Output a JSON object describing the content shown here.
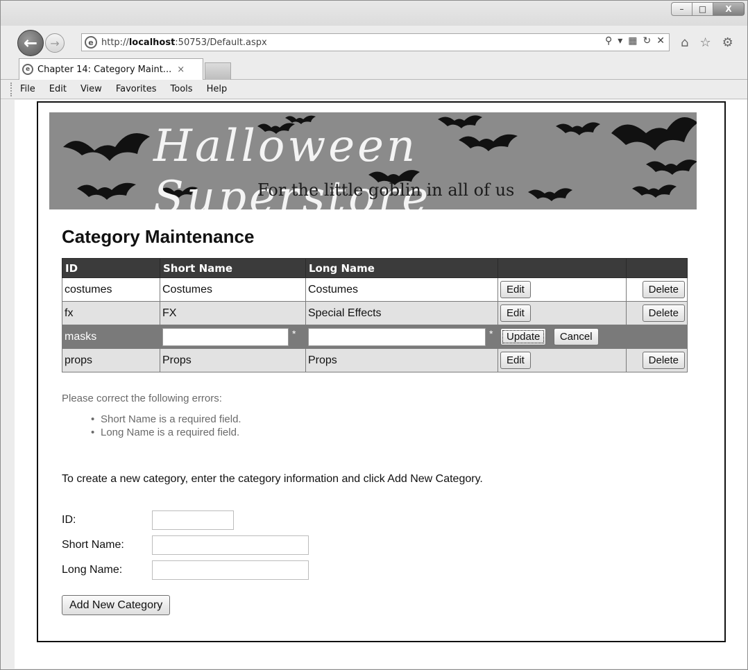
{
  "browser": {
    "url_prefix": "http://",
    "url_host": "localhost",
    "url_rest": ":50753/Default.aspx",
    "tab_title": "Chapter 14: Category Maint...",
    "tab_close": "×",
    "menu": [
      "File",
      "Edit",
      "View",
      "Favorites",
      "Tools",
      "Help"
    ],
    "window_buttons": {
      "minimize": "–",
      "maximize": "□",
      "close": "X"
    },
    "address_tools": {
      "search": "⚲",
      "dropdown": "▾",
      "compat": "▦",
      "refresh": "↻",
      "stop": "✕"
    },
    "nav_icons": {
      "home": "⌂",
      "favorites": "☆",
      "settings": "⚙"
    }
  },
  "banner": {
    "title": "Halloween Superstore",
    "tagline": "For the little goblin in all of us"
  },
  "page_title": "Category Maintenance",
  "grid": {
    "headers": [
      "ID",
      "Short Name",
      "Long Name",
      "",
      ""
    ],
    "rows": [
      {
        "id": "costumes",
        "short": "Costumes",
        "long": "Costumes",
        "edit": "Edit",
        "delete": "Delete"
      },
      {
        "id": "fx",
        "short": "FX",
        "long": "Special Effects",
        "edit": "Edit",
        "delete": "Delete"
      },
      {
        "id": "masks",
        "short_value": "",
        "long_value": "",
        "required_mark": "*",
        "update": "Update",
        "cancel": "Cancel"
      },
      {
        "id": "props",
        "short": "Props",
        "long": "Props",
        "edit": "Edit",
        "delete": "Delete"
      }
    ]
  },
  "validation": {
    "header": "Please correct the following errors:",
    "errors": [
      "Short Name is a required field.",
      "Long Name is a required field."
    ]
  },
  "instructions": "To create a new category, enter the category information and click Add New Category.",
  "form": {
    "id_label": "ID:",
    "id_value": "",
    "short_label": "Short Name:",
    "short_value": "",
    "long_label": "Long Name:",
    "long_value": "",
    "submit": "Add New Category"
  },
  "colors": {
    "grid_header": "#3b3b3b",
    "edit_row": "#7a7a7a",
    "alt_row": "#e2e2e2",
    "validation_text": "#6a6a6a",
    "banner_bg": "#8b8b8b"
  }
}
